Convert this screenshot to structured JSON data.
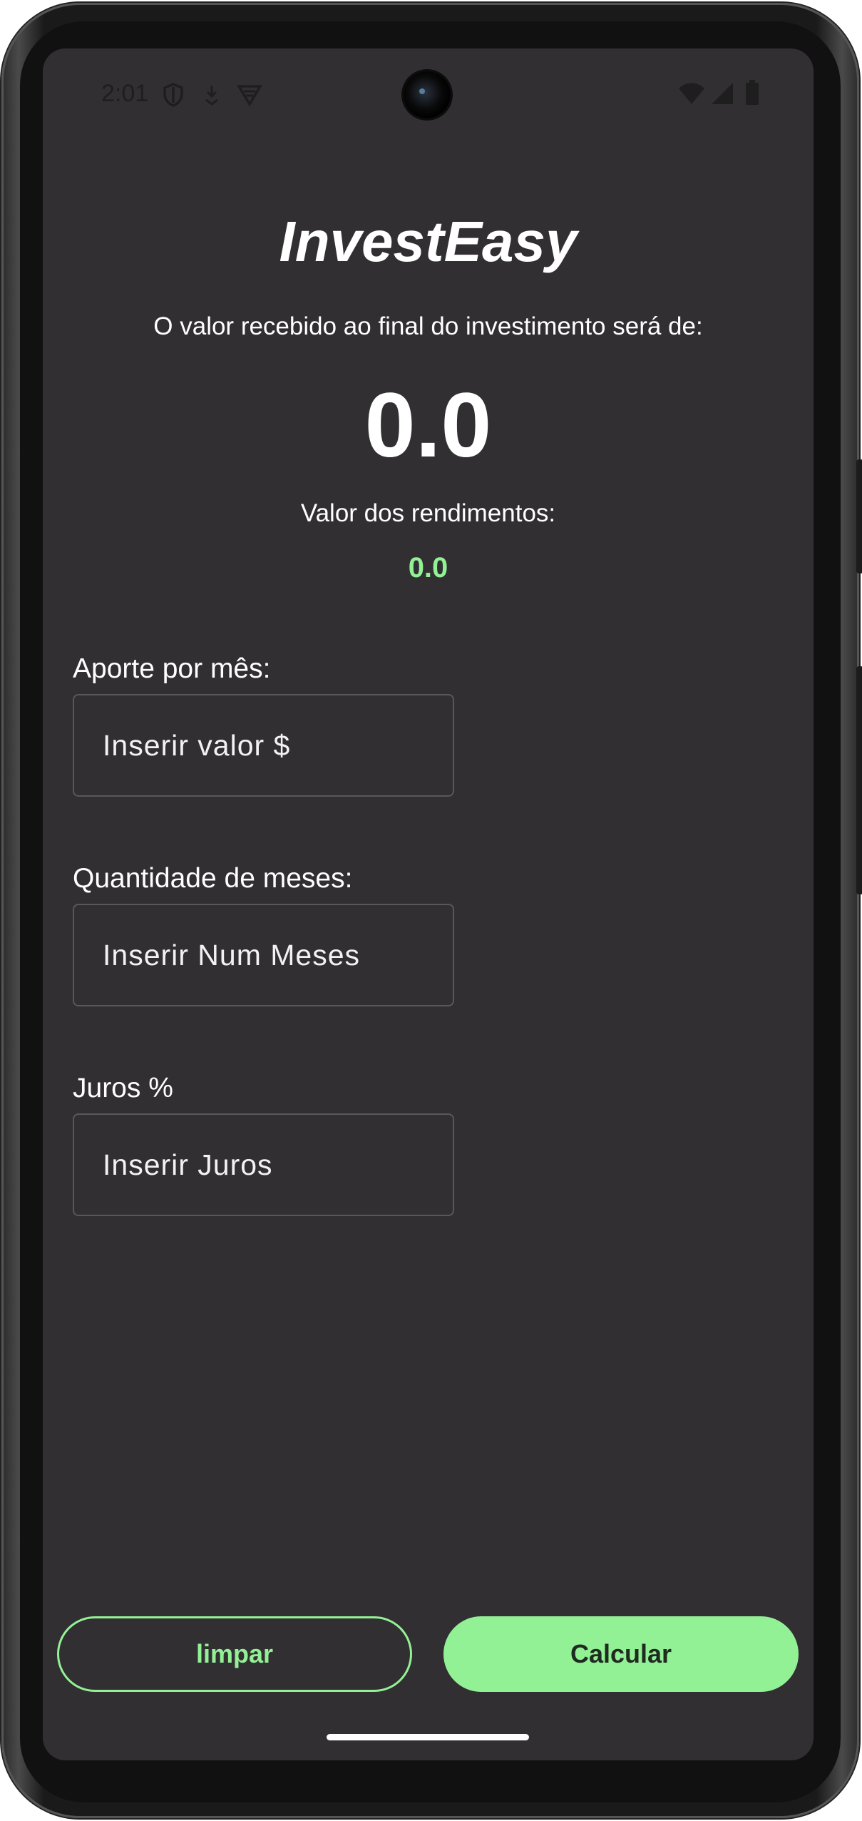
{
  "status_bar": {
    "time": "2:01",
    "icons": [
      "shield-icon",
      "download-notification-icon",
      "vpn-icon",
      "wifi-icon",
      "cellular-signal-icon",
      "battery-icon"
    ]
  },
  "app": {
    "title": "InvestEasy",
    "result_caption": "O valor recebido ao final do investimento será de:",
    "result_value": "0.0",
    "yield_caption": "Valor dos rendimentos:",
    "yield_value": "0.0"
  },
  "form": {
    "monthly_contribution": {
      "label": "Aporte por mês:",
      "value": "",
      "placeholder": "Inserir valor $"
    },
    "months": {
      "label": "Quantidade de meses:",
      "value": "",
      "placeholder": "Inserir Num Meses"
    },
    "interest": {
      "label": "Juros %",
      "value": "",
      "placeholder": "Inserir Juros"
    }
  },
  "actions": {
    "clear_label": "limpar",
    "calculate_label": "Calcular"
  },
  "colors": {
    "background": "#322f33",
    "accent": "#93f195",
    "text": "#ffffff",
    "input_border": "#5a575b"
  }
}
